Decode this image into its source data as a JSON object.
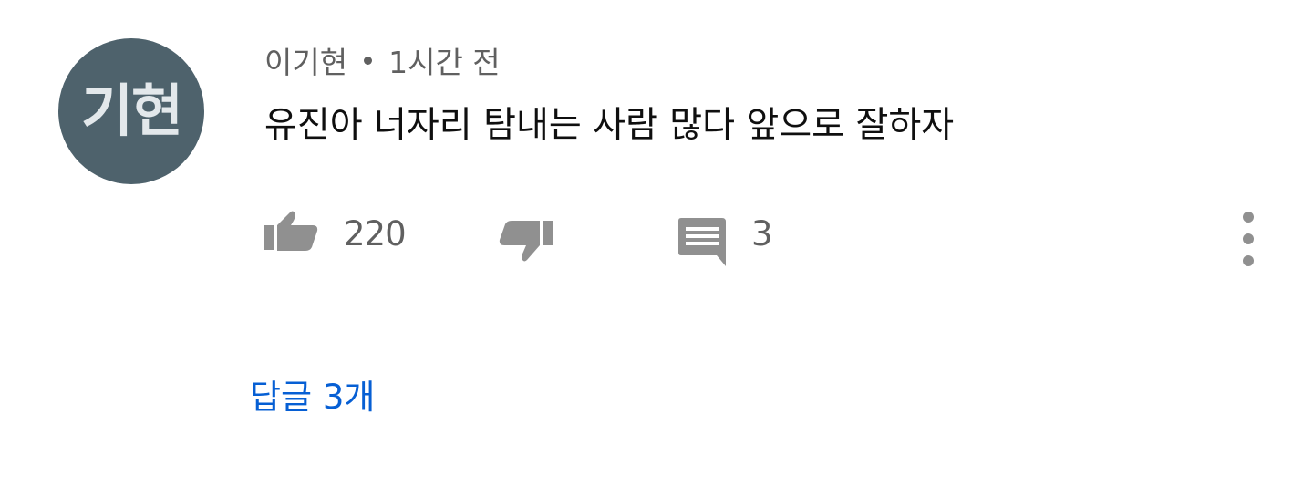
{
  "comment": {
    "avatar": {
      "initials": "기현",
      "background": "#4e626c"
    },
    "author": "이기현",
    "separator_icon": "dot",
    "timestamp": "1시간 전",
    "text": "유진아 너자리 탐내는 사람 많다 앞으로 잘하자",
    "like_icon": "thumb-up-icon",
    "like_count": "220",
    "dislike_icon": "thumb-down-icon",
    "reply_icon": "comment-icon",
    "reply_count": "3",
    "more_icon": "more-vertical-icon",
    "replies_link": "답글 3개",
    "link_color": "#065fd4"
  }
}
